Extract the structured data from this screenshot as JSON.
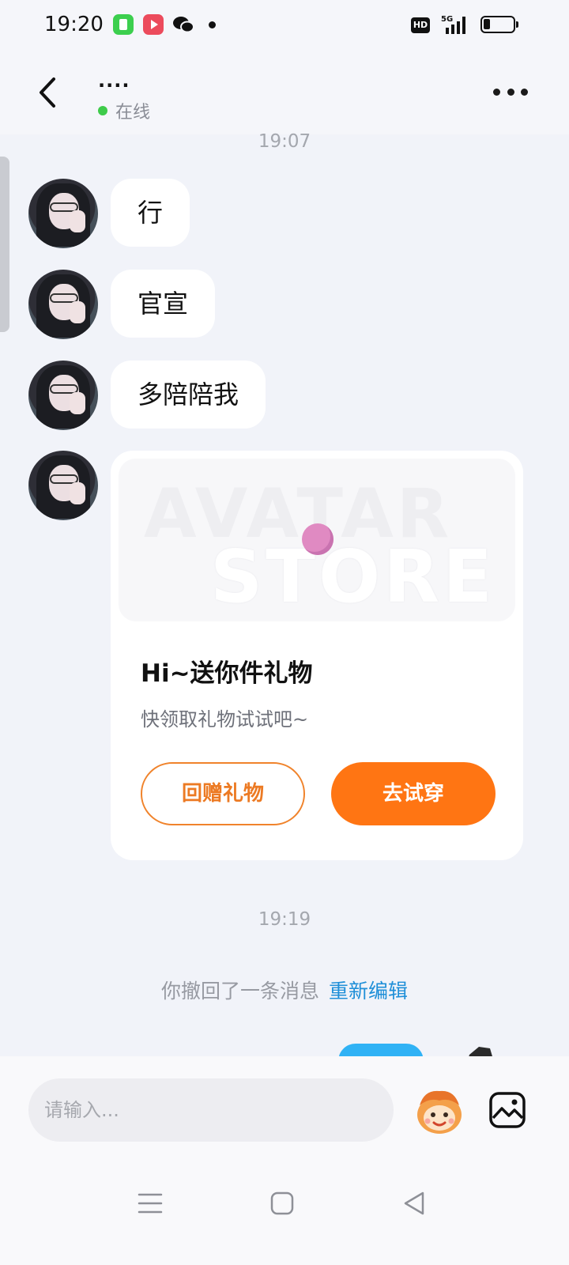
{
  "status_bar": {
    "time": "19:20",
    "network_badge": "HD",
    "network_type": "5G"
  },
  "header": {
    "contact_name": "....",
    "presence": "在线"
  },
  "chat": {
    "timestamp_1": "19:07",
    "messages": [
      {
        "text": "行"
      },
      {
        "text": "官宣"
      },
      {
        "text": "多陪陪我"
      }
    ],
    "gift_card": {
      "watermark_line_1": "AVATAR",
      "watermark_line_2": "STORE",
      "title": "Hi~送你件礼物",
      "subtitle": "快领取礼物试试吧~",
      "return_gift_label": "回赠礼物",
      "try_on_label": "去试穿"
    },
    "timestamp_2": "19:19",
    "recall_notice": "你撤回了一条消息",
    "reedit_label": "重新编辑"
  },
  "input": {
    "placeholder": "请输入..."
  },
  "colors": {
    "accent_orange": "#ff7513",
    "link_blue": "#1f8fd8",
    "online_green": "#3ecb4a",
    "my_bubble_blue": "#30b2f5"
  },
  "icons": [
    "back-icon",
    "more-icon",
    "emoji-icon",
    "image-icon",
    "menu-icon",
    "home-icon",
    "nav-back-icon"
  ]
}
